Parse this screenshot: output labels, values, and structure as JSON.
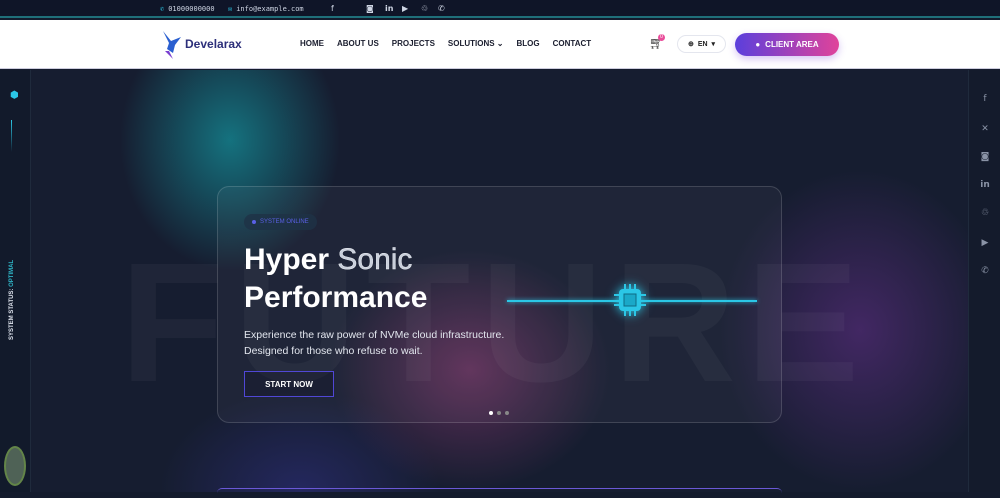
{
  "topbar": {
    "phone": "01000000000",
    "email": "info@example.com",
    "socials": [
      "facebook-icon",
      "instagram-icon",
      "linkedin-icon",
      "youtube-icon",
      "snapchat-icon",
      "whatsapp-icon"
    ]
  },
  "header": {
    "logo": "Develarax",
    "nav": [
      "HOME",
      "ABOUT US",
      "PROJECTS",
      "SOLUTIONS",
      "BLOG",
      "CONTACT"
    ],
    "cart_count": "0",
    "language": "EN",
    "client_area": "CLIENT AREA"
  },
  "sidebar": {
    "status_label": "SYSTEM STATUS:",
    "status_value": "OPTIMAL"
  },
  "right_socials": [
    "facebook-icon",
    "x-icon",
    "instagram-icon",
    "linkedin-icon",
    "snapchat-icon",
    "youtube-icon",
    "whatsapp-icon"
  ],
  "hero": {
    "watermark": "FUTURE",
    "badge": "SYSTEM ONLINE",
    "title_1": "Hyper",
    "title_outline": "Sonic",
    "title_2": "Performance",
    "description": "Experience the raw power of NVMe cloud infrastructure. Designed for those who refuse to wait.",
    "cta": "START NOW",
    "slides": 3,
    "active_slide": 1
  },
  "colors": {
    "accent": "#2bc7e6",
    "brand_start": "#5b3fdc",
    "brand_end": "#e0439a"
  }
}
